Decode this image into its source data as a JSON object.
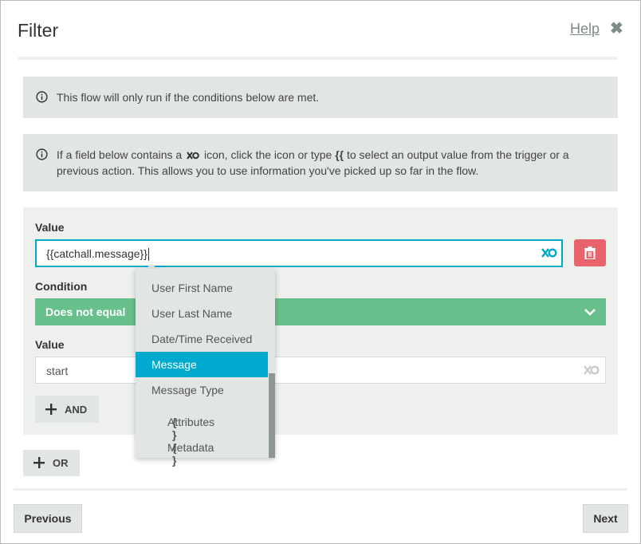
{
  "header": {
    "title": "Filter",
    "help_label": "Help",
    "close_glyph": "✖"
  },
  "info": {
    "line1": "This flow will only run if the conditions below are met.",
    "line2_a": "If a field below contains a",
    "line2_b": "icon, click the icon or type",
    "line2_braces": "{{",
    "line2_c": "to select an output value from the trigger or a previous action. This allows you to use information you've picked up so far in the flow."
  },
  "condition_group": {
    "value1_label": "Value",
    "value1_text": "{{catchall.message}}",
    "condition_label": "Condition",
    "condition_selected": "Does not equal",
    "value2_label": "Value",
    "value2_text": "start",
    "and_label": "AND"
  },
  "or_label": "OR",
  "footer": {
    "previous_label": "Previous",
    "next_label": "Next"
  },
  "dropdown": {
    "items": [
      {
        "label": "User First Name",
        "braces": ""
      },
      {
        "label": "User Last Name",
        "braces": ""
      },
      {
        "label": "Date/Time Received",
        "braces": ""
      },
      {
        "label": "Message",
        "braces": ""
      },
      {
        "label": "Message Type",
        "braces": ""
      },
      {
        "label": "Attributes",
        "braces": "{ }"
      },
      {
        "label": "Metadata",
        "braces": "{ }"
      }
    ],
    "selected_index": 3
  },
  "colors": {
    "accent": "#00aacf",
    "condition_green": "#67c08c",
    "delete_red": "#e8636b",
    "panel_gray": "#e1e5e3"
  },
  "icons": [
    "info-icon",
    "link-token-icon",
    "trash-icon",
    "chevron-down-icon",
    "plus-icon",
    "close-icon"
  ]
}
